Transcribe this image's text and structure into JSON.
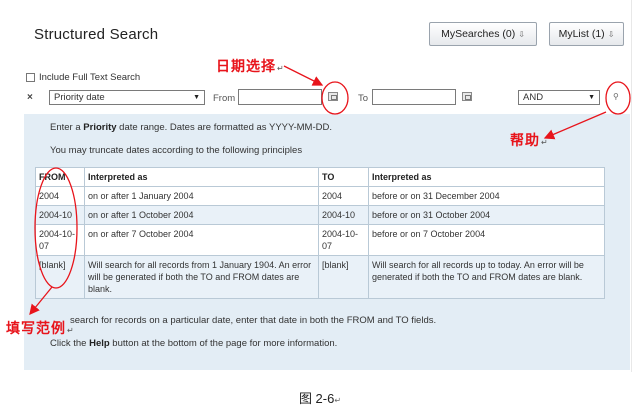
{
  "header": {
    "title": "Structured Search",
    "my_searches": "MySearches (0)",
    "my_list": "MyList (1)",
    "download_icon": "download-arrow"
  },
  "options": {
    "full_text_label": "Include Full Text Search"
  },
  "search_row": {
    "remove_label": "×",
    "field": "Priority date",
    "from_label": "From",
    "from_value": "",
    "to_label": "To",
    "to_value": "",
    "operator": "AND",
    "dropdown_icon": "▼"
  },
  "help_panel": {
    "intro_prefix": "Enter a ",
    "intro_bold": "Priority",
    "intro_suffix": " date range. Dates are formatted as YYYY-MM-DD.",
    "truncate_text": "You may truncate dates according to the following principles",
    "columns": [
      "FROM",
      "Interpreted as",
      "TO",
      "Interpreted as"
    ],
    "rows": [
      [
        "2004",
        "on or after 1 January 2004",
        "2004",
        "before or on 31 December 2004"
      ],
      [
        "2004-10",
        "on or after 1 October 2004",
        "2004-10",
        "before or on 31 October 2004"
      ],
      [
        "2004-10-07",
        "on or after 7 October 2004",
        "2004-10-07",
        "before or on 7 October 2004"
      ],
      [
        "[blank]",
        "Will search for all records from 1 January 1904. An error will be generated if both the TO and FROM dates are blank.",
        "[blank]",
        "Will search for all records up to today. An error will be generated if both the TO and FROM dates are blank."
      ]
    ],
    "particular_date_text": "search for records on a particular date, enter that date in both the FROM and TO fields.",
    "help_prefix": "Click the ",
    "help_bold": "Help",
    "help_suffix": " button at the bottom of the page for more information."
  },
  "annotations": {
    "date_select": "日期选择",
    "help": "帮助",
    "example": "填写范例",
    "return_mark": "↵",
    "color": "#e8141b"
  },
  "caption": "图 2-6"
}
